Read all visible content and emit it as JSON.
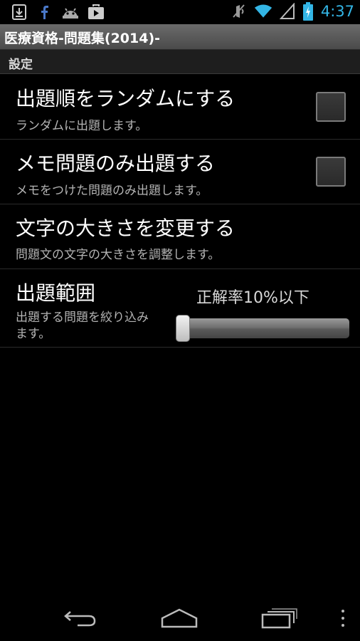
{
  "status_bar": {
    "time": "4:37",
    "left_icons": [
      "download-icon",
      "facebook-icon",
      "android-icon",
      "play-store-icon"
    ],
    "right_icons": [
      "mute-icon",
      "wifi-icon",
      "signal-icon",
      "battery-charging-icon"
    ],
    "accent_color": "#33b5e5"
  },
  "app_bar": {
    "title": "医療資格-問題集(2014)-"
  },
  "section_header": "設定",
  "preferences": [
    {
      "title": "出題順をランダムにする",
      "summary": "ランダムに出題します。",
      "checked": false
    },
    {
      "title": "メモ問題のみ出題する",
      "summary": "メモをつけた問題のみ出題します。",
      "checked": false
    },
    {
      "title": "文字の大きさを変更する",
      "summary": "問題文の文字の大きさを調整します。"
    }
  ],
  "range_pref": {
    "title": "出題範囲",
    "summary_line1": "出題する問題を絞り込み",
    "summary_line2": "ます。",
    "slider_label": "正解率10%以下",
    "slider_value": 0.0
  },
  "nav_bar": {
    "icons": [
      "back-icon",
      "home-icon",
      "recents-icon",
      "overflow-menu-icon"
    ]
  }
}
